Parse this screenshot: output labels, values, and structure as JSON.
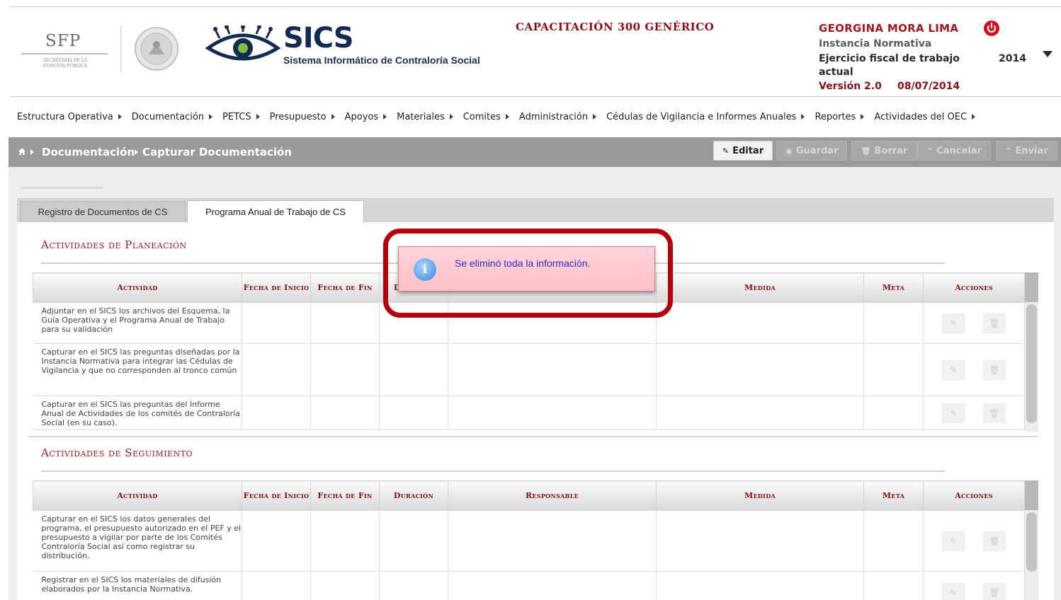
{
  "header": {
    "sfp_logo": "SFP",
    "sfp_subtitle": "SECRETARÍA DE LA FUNCIÓN PÚBLICA",
    "system_name": "SICS",
    "system_subtitle": "Sistema Informático de Contraloría Social",
    "capacitacion_title": "CAPACITACIÓN 300 GENÉRICO",
    "user_name": "GEORGINA MORA LIMA",
    "instancia": "Instancia Normativa",
    "ejercicio_label": "Ejercicio fiscal de trabajo actual",
    "ejercicio_year": "2014",
    "version": "Versión 2.0",
    "version_date": "08/07/2014"
  },
  "menu": [
    "Estructura Operativa",
    "Documentación",
    "PETCS",
    "Presupuesto",
    "Apoyos",
    "Materiales",
    "Comites",
    "Administración",
    "Cédulas de Vigilancia e Informes Anuales",
    "Reportes",
    "Actividades del OEC"
  ],
  "breadcrumb": {
    "level1": "Documentación",
    "level2": "Capturar Documentación"
  },
  "toolbar": {
    "editar": "Editar",
    "guardar": "Guardar",
    "borrar": "Borrar",
    "cancelar": "Cancelar",
    "enviar": "Enviar"
  },
  "tabs": {
    "registro": "Registro de Documentos de CS",
    "programa": "Programa Anual de Trabajo de CS"
  },
  "columns": {
    "actividad": "Actividad",
    "fecha_inicio": "Fecha de Inicio",
    "fecha_fin": "Fecha de Fin",
    "duracion": "Duración",
    "responsable": "Responsable",
    "medida": "Medida",
    "meta": "Meta",
    "acciones": "Acciones"
  },
  "planeacion": {
    "title": "Actividades de Planeación",
    "rows": [
      "Adjuntar en el SICS los archivos del Esquema, la Guía Operativa y el Programa Anual de Trabajo para su validación",
      "Capturar en el SICS las preguntas diseñadas por la Instancia Normativa para integrar las Cédulas de Vigilancia y que no corresponden al tronco común",
      "Capturar en el SICS las preguntas del Informe Anual de Actividades de los comités de Contraloría Social (en su caso)."
    ]
  },
  "seguimiento": {
    "title": "Actividades de Seguimiento",
    "rows": [
      "Capturar en el SICS los datos generales del programa, el presupuesto autorizado en el PEF y el presupuesto a vigilar por parte de los Comités Contraloría Social así como registrar su distribución.",
      "Registrar en el SICS los materiales de difusión elaborados por la Instancia Normativa."
    ]
  },
  "popup": {
    "message": "Se eliminó toda la información."
  },
  "icons": {
    "power": "power-icon",
    "dropdown": "chevron-down-icon",
    "home": "home-icon",
    "edit": "pencil-icon",
    "delete": "trash-icon",
    "info": "info-icon"
  },
  "colors": {
    "brand_red": "#a11a21",
    "navy": "#132b52",
    "crumb_bar": "#9a9a9a",
    "popup_bg": "#ffc0c7",
    "highlight": "#b5000b"
  }
}
